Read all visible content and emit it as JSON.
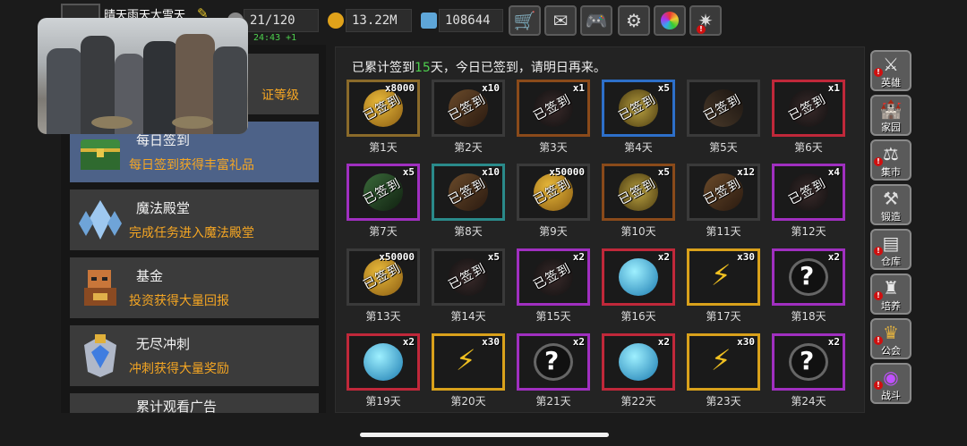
{
  "header": {
    "player_name": "晴天雨天大雪天",
    "energy": "21/120",
    "gold": "13.22M",
    "gems": "108644",
    "timer": "24:43 +1",
    "buttons": [
      "shop-cart-icon",
      "mail-icon",
      "gamepad-icon",
      "gear-icon",
      "color-wheel-icon",
      "firework-icon"
    ]
  },
  "menu": [
    {
      "title": "",
      "desc": "证等级"
    },
    {
      "title": "每日签到",
      "desc": "每日签到获得丰富礼品"
    },
    {
      "title": "魔法殿堂",
      "desc": "完成任务进入魔法殿堂"
    },
    {
      "title": "基金",
      "desc": "投资获得大量回报"
    },
    {
      "title": "无尽冲刺",
      "desc": "冲刺获得大量奖励"
    },
    {
      "title": "累计观看广告",
      "desc": ""
    }
  ],
  "signin": {
    "message_prefix": "已累计签到",
    "count": "15",
    "message_suffix": "天，今日已签到，请明日再来。",
    "stamp": "已签到",
    "days": [
      {
        "label": "第1天",
        "qty": "x8000",
        "claimed": true,
        "kind": "coin"
      },
      {
        "label": "第2天",
        "qty": "x10",
        "claimed": true,
        "kind": "scroll"
      },
      {
        "label": "第3天",
        "qty": "x1",
        "claimed": true,
        "kind": "gear"
      },
      {
        "label": "第4天",
        "qty": "x5",
        "claimed": true,
        "kind": "ore"
      },
      {
        "label": "第5天",
        "qty": "",
        "claimed": true,
        "kind": "rune"
      },
      {
        "label": "第6天",
        "qty": "x1",
        "claimed": true,
        "kind": "gear"
      },
      {
        "label": "第7天",
        "qty": "x5",
        "claimed": true,
        "kind": "book"
      },
      {
        "label": "第8天",
        "qty": "x10",
        "claimed": true,
        "kind": "scroll"
      },
      {
        "label": "第9天",
        "qty": "x50000",
        "claimed": true,
        "kind": "coin"
      },
      {
        "label": "第10天",
        "qty": "x5",
        "claimed": true,
        "kind": "ore"
      },
      {
        "label": "第11天",
        "qty": "x12",
        "claimed": true,
        "kind": "scroll"
      },
      {
        "label": "第12天",
        "qty": "x4",
        "claimed": true,
        "kind": "gear"
      },
      {
        "label": "第13天",
        "qty": "x50000",
        "claimed": true,
        "kind": "coin"
      },
      {
        "label": "第14天",
        "qty": "x5",
        "claimed": true,
        "kind": "gear"
      },
      {
        "label": "第15天",
        "qty": "x2",
        "claimed": true,
        "kind": "gear"
      },
      {
        "label": "第16天",
        "qty": "x2",
        "claimed": false,
        "kind": "orb"
      },
      {
        "label": "第17天",
        "qty": "x30",
        "claimed": false,
        "kind": "bolt"
      },
      {
        "label": "第18天",
        "qty": "x2",
        "claimed": false,
        "kind": "mystery"
      },
      {
        "label": "第19天",
        "qty": "x2",
        "claimed": false,
        "kind": "orb"
      },
      {
        "label": "第20天",
        "qty": "x30",
        "claimed": false,
        "kind": "bolt"
      },
      {
        "label": "第21天",
        "qty": "x2",
        "claimed": false,
        "kind": "mystery"
      },
      {
        "label": "第22天",
        "qty": "x2",
        "claimed": false,
        "kind": "orb"
      },
      {
        "label": "第23天",
        "qty": "x30",
        "claimed": false,
        "kind": "bolt"
      },
      {
        "label": "第24天",
        "qty": "x2",
        "claimed": false,
        "kind": "mystery"
      }
    ]
  },
  "rail": [
    {
      "label": "英雄",
      "icon": "hero-icon",
      "alert": true
    },
    {
      "label": "家园",
      "icon": "castle-icon",
      "alert": false
    },
    {
      "label": "集市",
      "icon": "market-icon",
      "alert": true
    },
    {
      "label": "锻造",
      "icon": "anvil-icon",
      "alert": false
    },
    {
      "label": "仓库",
      "icon": "warehouse-icon",
      "alert": true
    },
    {
      "label": "培养",
      "icon": "training-icon",
      "alert": true
    },
    {
      "label": "公会",
      "icon": "guild-icon",
      "alert": true
    },
    {
      "label": "战斗",
      "icon": "portal-icon",
      "alert": true
    }
  ],
  "colors": {
    "accent_orange": "#f5a623",
    "accent_green": "#4ed04e",
    "active_menu": "#4d6288",
    "purple_border": "#a02fc0",
    "red_border": "#c0283a",
    "gold_border": "#d9a11b",
    "blue_border": "#2d6fc9"
  }
}
